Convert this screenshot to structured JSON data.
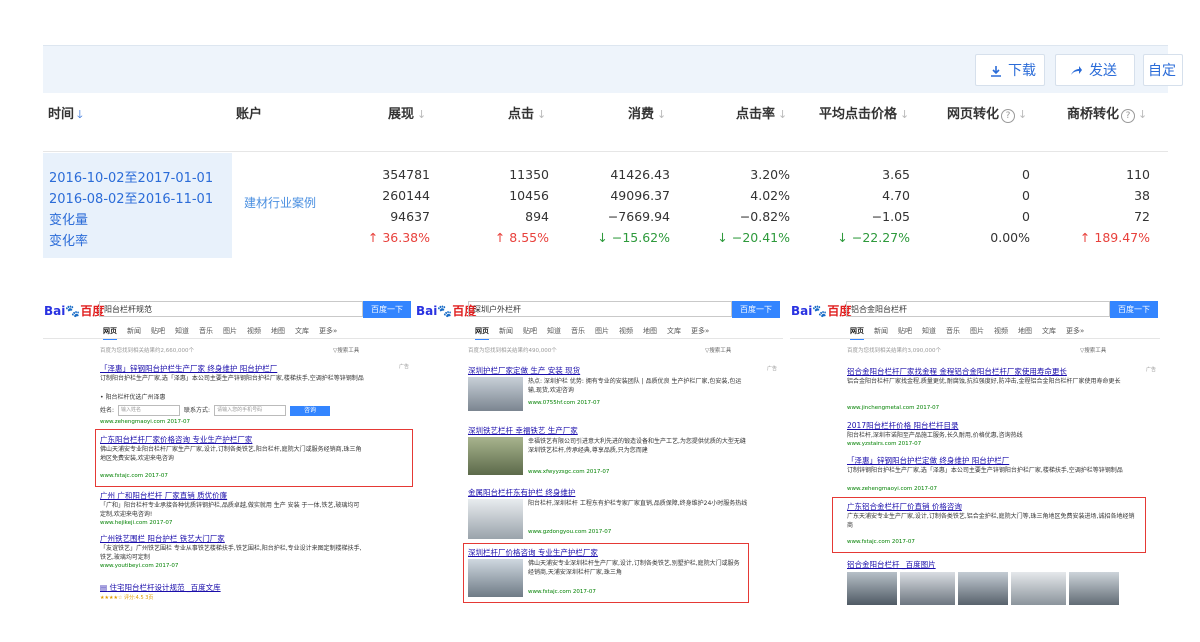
{
  "toolbar": {
    "download_label": "下载",
    "send_label": "发送",
    "custom_label": "自定"
  },
  "table": {
    "headers": {
      "time": "时间",
      "account": "账户",
      "impressions": "展现",
      "clicks": "点击",
      "cost": "消费",
      "ctr": "点击率",
      "avg_cpc": "平均点击价格",
      "web_conv": "网页转化",
      "bridge_conv": "商桥转化"
    },
    "period1": "2016-10-02至2017-01-01",
    "period2": "2016-08-02至2016-11-01",
    "change": "变化量",
    "change_rate": "变化率",
    "account_name": "建材行业案例",
    "rows": [
      {
        "impressions": "354781",
        "clicks": "11350",
        "cost": "41426.43",
        "ctr": "3.20%",
        "avg_cpc": "3.65",
        "web_conv": "0",
        "bridge_conv": "110"
      },
      {
        "impressions": "260144",
        "clicks": "10456",
        "cost": "49096.37",
        "ctr": "4.02%",
        "avg_cpc": "4.70",
        "web_conv": "0",
        "bridge_conv": "38"
      },
      {
        "impressions": "94637",
        "clicks": "894",
        "cost": "−7669.94",
        "ctr": "−0.82%",
        "avg_cpc": "−1.05",
        "web_conv": "0",
        "bridge_conv": "72"
      }
    ],
    "rates": {
      "impressions": "36.38%",
      "clicks": "8.55%",
      "cost": "−15.62%",
      "ctr": "−20.41%",
      "avg_cpc": "−22.27%",
      "web_conv": "0.00%",
      "bridge_conv": "189.47%"
    }
  },
  "colors": {
    "accent": "#2b6cd8",
    "up": "#e8413c",
    "down": "#2e9a3c",
    "highlight": "#e53935"
  },
  "serp": {
    "logo_a": "Bai",
    "logo_b": "百度",
    "search_btn": "百度一下",
    "nav": [
      "网页",
      "新闻",
      "贴吧",
      "知道",
      "音乐",
      "图片",
      "视频",
      "地图",
      "文库",
      "更多»"
    ],
    "tools": "搜索工具",
    "ad": "广告",
    "shots": [
      {
        "query": "阳台栏杆规范",
        "meta": "百度为您找到相关结果约2,660,000个",
        "r1_title": "「泽惠」锌钢阳台护栏生产厂家 终身维护 阳台护栏厂",
        "r1_desc": "订制阳台护栏生产厂家,选「泽惠」本公司主要生产锌钢阳台护栏厂家,楼梯扶手,空调护栏等锌钢制品",
        "r1_sub": "• 阳台栏杆优选广州泽惠",
        "form_name": "姓名:",
        "form_name_ph": "输入姓名",
        "form_phone": "联系方式:",
        "form_phone_ph": "请输入您的手机号码",
        "form_btn": "咨询",
        "r1_url": "www.zehengmaoyi.com  2017-07",
        "r2_title": "广东阳台栏杆厂家价格咨询 专业生产护栏厂家",
        "r2_desc": "佛山天浦安专业阳台栏杆厂家生产厂家,设计,订制各类铁艺,阳台栏杆,庭院大门或服务经销商,珠三角地区免费安装,欢迎来电咨询",
        "r2_url": "www.fstajc.com  2017-07",
        "r3_title": "广州 广和阳台栏杆 厂家直销 质优价廉",
        "r3_desc": "「广和」阳台栏杆专业承接各种优质锌钢护栏,品质卓越,做实就用 生产 安装 于一体,铁艺,玻璃均可定制,欢迎来电咨询!",
        "r3_url": "www.hejikeji.com  2017-07",
        "r4_title": "广州铁艺围栏 阳台护栏 铁艺大门厂家",
        "r4_desc": "「友谊铁艺」广州铁艺围栏 专业从事铁艺楼梯扶手,铁艺围栏,阳台护栏,专业设计来图定制楼梯扶手,铁艺,玻璃均可定制",
        "r4_url": "www.youtibeyi.com  2017-07",
        "r5_title": "住宅阳台栏杆设计规范 _百度文库",
        "r5_rating": "★★★★☆ 评分:4.5 3页"
      },
      {
        "query": "深圳户外栏杆",
        "meta": "百度为您找到相关结果约490,000个",
        "r1_title": "深圳护栏厂家定做 生产 安装 现货",
        "r1_desc": "热点: 深圳护栏  优势: 拥有专业的安装团队 | 品质优良 生产护栏厂家,包安装,包运输,现货,欢迎咨询",
        "r1_url": "www.0755hf.com  2017-07",
        "r2_title": "深圳铁艺栏杆 幸福铁艺 生产厂家",
        "r2_desc": "幸福铁艺有限公司引进意大利先进的锻造设备和生产工艺,为您提供优质的大型无缝深圳铁艺栏杆,传承经典,尊享品质,只为您而建",
        "r2_url": "www.xfwyyzsgc.com  2017-07",
        "r3_title": "金属阳台栏杆东有护栏 终身维护",
        "r3_desc": "阳台栏杆,深圳栏杆 工程东有护栏专家厂家直销,品质保障,终身维护24小时服务热线",
        "r3_url": "www.gzdongyou.com  2017-07",
        "r4_title": "深圳栏杆厂价格咨询 专业生产护栏厂家",
        "r4_desc": "佛山天浦安专业深圳栏杆生产厂家,设计,订制各类铁艺,别墅护栏,庭院大门或服务经销商,天浦安深圳栏杆厂家,珠三角",
        "r4_url": "www.fstajc.com  2017-07"
      },
      {
        "query": "铝合金阳台栏杆",
        "meta": "百度为您找到相关结果约3,090,000个",
        "r1_title": "铝合金阳台栏杆厂家找金程 金程铝合金阳台栏杆厂家使用寿命更长",
        "r1_desc": "铝合金阳台栏杆厂家找金程,质量更优,耐腐蚀,抗拉强度好,防冲击,金程铝合金阳台栏杆厂家使用寿命更长",
        "r1_url": "www.jinchengmetal.com  2017-07",
        "r2_title": "2017阳台栏杆价格 阳台栏杆目录",
        "r2_desc": "阳台栏杆,深圳市诺阳至产品施工服务,长久耐用,价格优惠,咨询热线",
        "r2_url": "www.yzstairs.com  2017-07",
        "r3_title": "「泽惠」锌钢阳台护栏定做 终身维护 阳台护栏厂",
        "r3_desc": "订制锌钢阳台护栏生产厂家,选「泽惠」本公司主要生产锌钢阳台护栏厂家,楼梯扶手,空调护栏等锌钢制品",
        "r3_url": "www.zehengmaoyi.com  2017-07",
        "r4_title": "广东铝合金栏杆厂价直销 价格咨询",
        "r4_desc": "广东天浦安专业生产厂家,设计,订制各类铁艺,铝合金护栏,庭院大门等,珠三角地区免费安装进场,诚招各地经销商",
        "r4_url": "www.fstajc.com  2017-07",
        "r5_title": "铝合金阳台栏杆 _百度图片"
      }
    ]
  }
}
